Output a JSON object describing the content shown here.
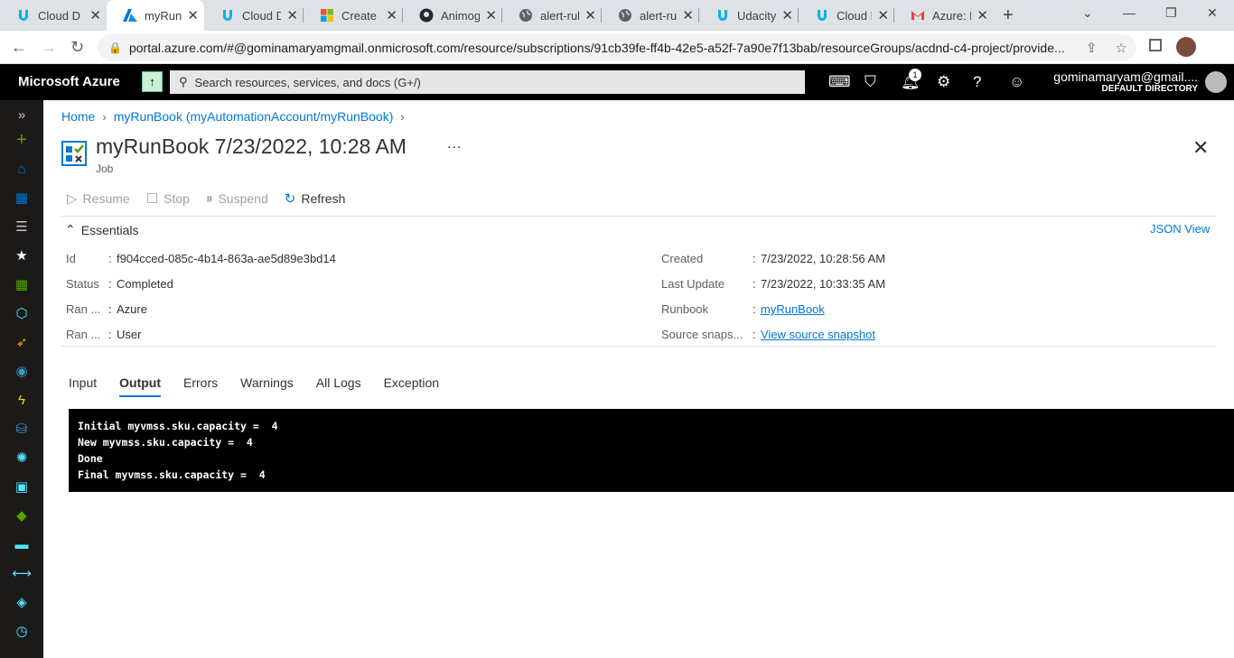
{
  "browser": {
    "tabs": [
      {
        "title": "Cloud D",
        "icon": "udacity-icon"
      },
      {
        "title": "myRunB",
        "icon": "azure-icon",
        "active": true
      },
      {
        "title": "Cloud D",
        "icon": "udacity-icon"
      },
      {
        "title": "Create a",
        "icon": "microsoft-icon"
      },
      {
        "title": "Animog",
        "icon": "github-icon"
      },
      {
        "title": "alert-rul",
        "icon": "globe-icon"
      },
      {
        "title": "alert-rul",
        "icon": "globe-icon"
      },
      {
        "title": "Udacity",
        "icon": "udacity-icon"
      },
      {
        "title": "Cloud D",
        "icon": "udacity-icon"
      },
      {
        "title": "Azure: D",
        "icon": "gmail-icon"
      }
    ],
    "url": "portal.azure.com/#@gominamaryamgmail.onmicrosoft.com/resource/subscriptions/91cb39fe-ff4b-42e5-a52f-7a90e7f13bab/resourceGroups/acdnd-c4-project/provide..."
  },
  "azure": {
    "brand": "Microsoft Azure",
    "search_placeholder": "Search resources, services, and docs (G+/)",
    "notification_count": "1",
    "account_name": "gominamaryam@gmail....",
    "directory": "DEFAULT DIRECTORY"
  },
  "breadcrumb": {
    "home": "Home",
    "parent": "myRunBook (myAutomationAccount/myRunBook)"
  },
  "header": {
    "title": "myRunBook 7/23/2022, 10:28 AM",
    "subtitle": "Job",
    "more": "..."
  },
  "toolbar": {
    "resume": "Resume",
    "stop": "Stop",
    "suspend": "Suspend",
    "refresh": "Refresh"
  },
  "essentials": {
    "heading": "Essentials",
    "json_view": "JSON View",
    "left": [
      {
        "label": "Id",
        "value": "f904cced-085c-4b14-863a-ae5d89e3bd14"
      },
      {
        "label": "Status",
        "value": "Completed"
      },
      {
        "label": "Ran ...",
        "value": "Azure"
      },
      {
        "label": "Ran ...",
        "value": "User"
      }
    ],
    "right": [
      {
        "label": "Created",
        "value": "7/23/2022, 10:28:56 AM"
      },
      {
        "label": "Last Update",
        "value": "7/23/2022, 10:33:35 AM"
      },
      {
        "label": "Runbook",
        "value": "myRunBook"
      },
      {
        "label": "Source snaps...",
        "value": "View source snapshot"
      }
    ]
  },
  "output_tabs": [
    "Input",
    "Output",
    "Errors",
    "Warnings",
    "All Logs",
    "Exception"
  ],
  "selected_tab": "Output",
  "output_lines": [
    "Initial myvmss.sku.capacity =  4",
    "New myvmss.sku.capacity =  4",
    "Done",
    "Final myvmss.sku.capacity =  4"
  ],
  "colors": {
    "accent": "#0078d4",
    "topbar": "#000000",
    "leftnav": "#1b1a19"
  }
}
